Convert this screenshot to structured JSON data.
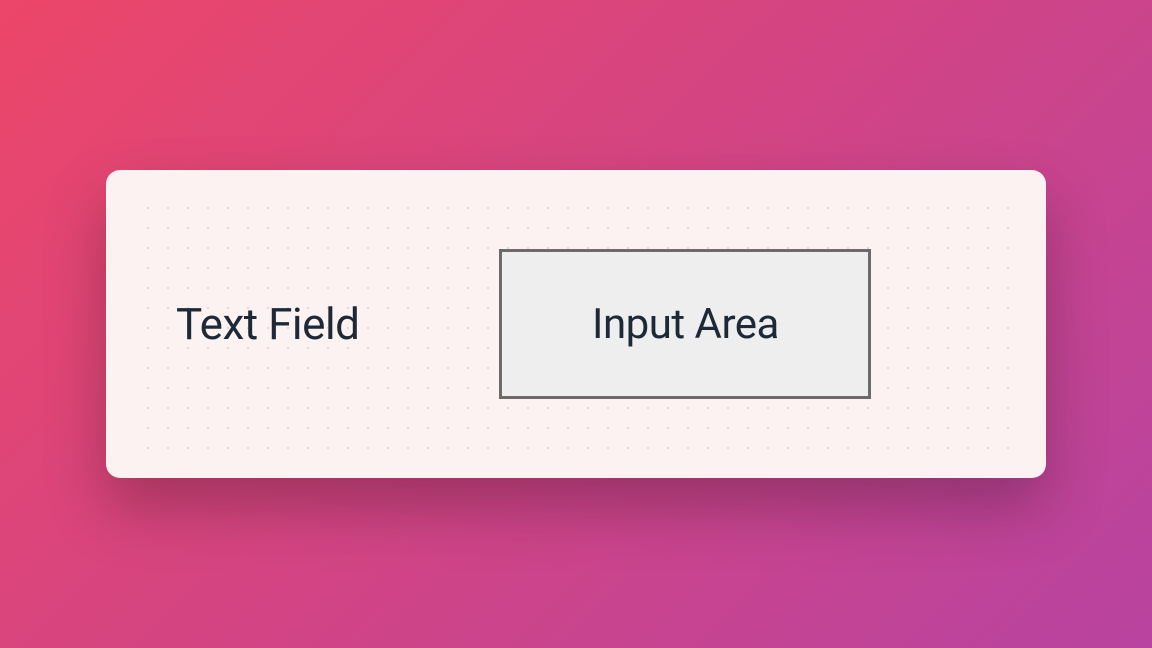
{
  "form": {
    "label": "Text Field",
    "input_placeholder": "Input Area"
  }
}
